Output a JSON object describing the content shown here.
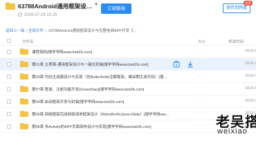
{
  "header": {
    "title": "63788Android通用框架设计与...",
    "date": "2016-07-29 15:25",
    "order_button": "订阅链接",
    "save_button": "保存到网盘",
    "save_badge": "超级"
  },
  "breadcrumb": {
    "back": "返回上一级",
    "all_files": "全部文件",
    "current": "63788Android通用框架设计与完整电商APP开发【..."
  },
  "table": {
    "col_name": "文件名",
    "col_size": "大小",
    "col_time": "修改时间",
    "rows": [
      {
        "name": "课程资料[搜学学网www.bxb2b.com]",
        "size": "-",
        "time": "2018-0"
      },
      {
        "name": "第01章 主界面-通用框架设计与一键式封装[搜学学网www.bxb2b.com]",
        "size": "-",
        "time": "2018-0"
      },
      {
        "name": "第03章 代码生成器设计与实现（仿ButterKnife注解框架，编译期生成代码）[搜学学网www.bxb2b.com]",
        "size": "-",
        "time": "2018-0"
      },
      {
        "name": "第07章 登录、注册功能开发(GreenDao)[搜学学网www.bxb2b.com]",
        "size": "-",
        "time": "2018-0"
      },
      {
        "name": "第04章 启动框架开发与封装[搜学学网www.bxb2b.com]",
        "size": "-",
        "time": "2018-0"
      },
      {
        "name": "第05章 网络框架完成网络请求框架设计（Retrofit+RxJava+Glide）[搜学学网www.bxb2b.com]",
        "size": "-",
        "time": "2018-0"
      },
      {
        "name": "第06章 多Activity的APP页面架构设计与实现[搜学学网www.bxb2b.com]",
        "size": "-",
        "time": "2018-0"
      }
    ]
  },
  "watermark": {
    "cn": "老吴搭",
    "en": "weixiao"
  },
  "colors": {
    "accent": "#2a8bf2",
    "folder": "#f5c344",
    "row_highlight": "#eaf3fd"
  }
}
